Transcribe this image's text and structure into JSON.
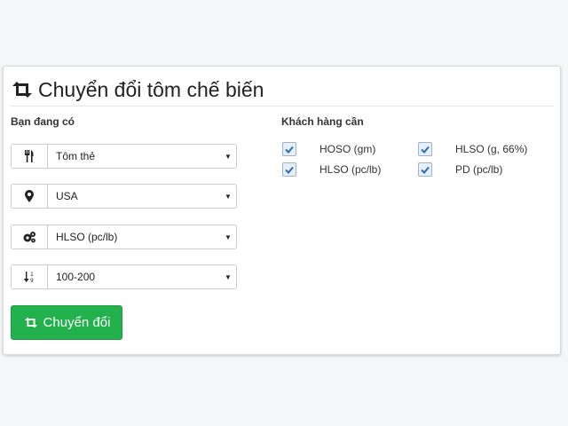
{
  "panel": {
    "title": "Chuyển đổi tôm chế biến",
    "title_icon": "retweet-icon"
  },
  "left": {
    "label": "Bạn đang có",
    "selects": [
      {
        "icon": "cutlery-icon",
        "value": "Tôm thẻ"
      },
      {
        "icon": "map-marker-icon",
        "value": "USA"
      },
      {
        "icon": "cogs-icon",
        "value": "HLSO (pc/lb)"
      },
      {
        "icon": "sort-numeric-icon",
        "value": "100-200"
      }
    ],
    "button_label": "Chuyển đổi",
    "button_icon": "retweet-icon"
  },
  "right": {
    "label": "Khách hàng cần",
    "checkboxes": [
      {
        "label": "HOSO (gm)",
        "checked": true
      },
      {
        "label": "HLSO (g, 66%)",
        "checked": true
      },
      {
        "label": "HLSO (pc/lb)",
        "checked": true
      },
      {
        "label": "PD (pc/lb)",
        "checked": true
      }
    ]
  },
  "colors": {
    "button": "#22b14c",
    "checkbox_check": "#2a6db5"
  }
}
